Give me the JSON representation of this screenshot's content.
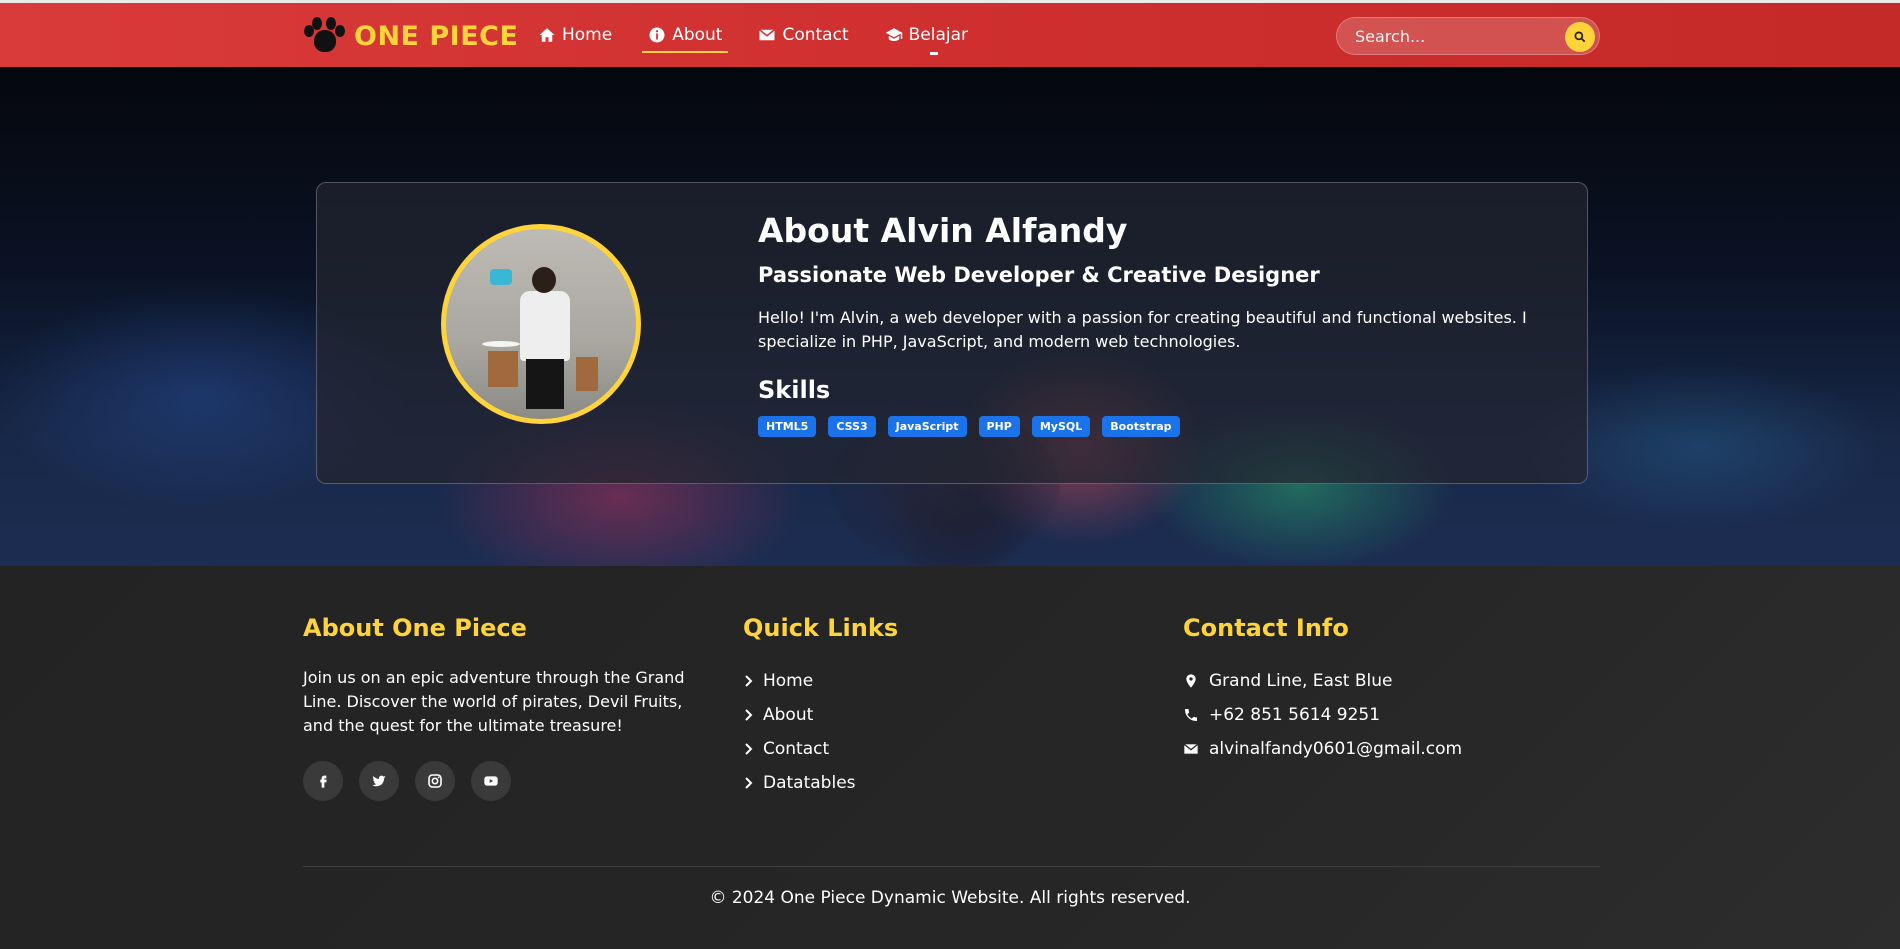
{
  "brand": {
    "name": "ONE PIECE",
    "icon": "paw-icon",
    "color": "#ffd43b"
  },
  "nav": {
    "items": [
      {
        "label": "Home",
        "icon": "home-icon"
      },
      {
        "label": "About",
        "icon": "info-icon",
        "active": true
      },
      {
        "label": "Contact",
        "icon": "envelope-icon"
      },
      {
        "label": "Belajar",
        "icon": "graduation-cap-icon"
      }
    ]
  },
  "search": {
    "placeholder": "Search..."
  },
  "about": {
    "title": "About Alvin Alfandy",
    "subtitle": "Passionate Web Developer & Creative Designer",
    "text": "Hello! I'm Alvin, a web developer with a passion for creating beautiful and functional websites. I specialize in PHP, JavaScript, and modern web technologies.",
    "skills_title": "Skills",
    "skills": [
      "HTML5",
      "CSS3",
      "JavaScript",
      "PHP",
      "MySQL",
      "Bootstrap"
    ]
  },
  "footer": {
    "about_title": "About One Piece",
    "about_text": "Join us on an epic adventure through the Grand Line. Discover the world of pirates, Devil Fruits, and the quest for the ultimate treasure!",
    "socials": [
      "facebook-icon",
      "twitter-icon",
      "instagram-icon",
      "youtube-icon"
    ],
    "links_title": "Quick Links",
    "links": [
      "Home",
      "About",
      "Contact",
      "Datatables"
    ],
    "contact_title": "Contact Info",
    "contacts": {
      "address": "Grand Line, East Blue",
      "phone": "+62 851 5614 9251",
      "email": "alvinalfandy0601@gmail.com"
    },
    "copyright": "© 2024 One Piece Dynamic Website. All rights reserved."
  }
}
